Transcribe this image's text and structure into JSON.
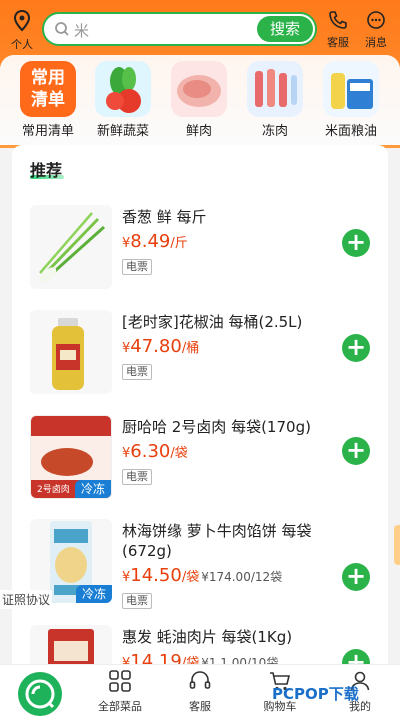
{
  "top": {
    "location_label": "个人",
    "search_placeholder": "米",
    "search_button": "搜索",
    "service_label": "客服",
    "message_label": "消息"
  },
  "categories": [
    {
      "label": "常用清单",
      "icon_text": "常用清单"
    },
    {
      "label": "新鲜蔬菜"
    },
    {
      "label": "鲜肉"
    },
    {
      "label": "冻肉"
    },
    {
      "label": "米面粮油"
    }
  ],
  "section_title": "推荐",
  "products": [
    {
      "title": "香葱 鲜 每斤",
      "price": "8.49",
      "unit": "/斤",
      "sub_price": "",
      "badge": "电票",
      "frozen": ""
    },
    {
      "title": "[老时家]花椒油 每桶(2.5L)",
      "price": "47.80",
      "unit": "/桶",
      "sub_price": "",
      "badge": "电票",
      "frozen": ""
    },
    {
      "title": "厨哈哈 2号卤肉 每袋(170g)",
      "price": "6.30",
      "unit": "/袋",
      "sub_price": "",
      "badge": "电票",
      "frozen": "冷冻",
      "thumb_caption": "2号卤肉"
    },
    {
      "title": "林海饼缘 萝卜牛肉馅饼 每袋(672g)",
      "price": "14.50",
      "unit": "/袋",
      "sub_price": "¥174.00/12袋",
      "badge": "电票",
      "frozen": "冷冻"
    },
    {
      "title": "惠发 蚝油肉片 每袋(1Kg)",
      "price": "14.19",
      "unit": "/袋",
      "sub_price": "¥1 1.00/10袋",
      "badge": "",
      "frozen": ""
    }
  ],
  "currency": "¥",
  "agreement": "证照协议",
  "bottom_nav": {
    "all_dishes": "全部菜品",
    "service": "客服",
    "cart": "购物车",
    "mine": "我的"
  },
  "watermark": "PCPOP下载",
  "colors": {
    "primary_green": "#2bb34a",
    "orange": "#ff7a1a",
    "price_red": "#e8400c",
    "frozen_blue": "#1a7fd4"
  }
}
